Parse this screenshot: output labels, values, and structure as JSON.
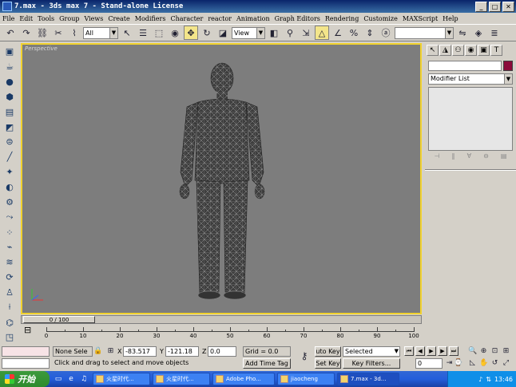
{
  "window": {
    "title": "7.max - 3ds max 7 - Stand-alone License",
    "min_label": "_",
    "max_label": "□",
    "close_label": "✕"
  },
  "menu": [
    "File",
    "Edit",
    "Tools",
    "Group",
    "Views",
    "Create",
    "Modifiers",
    "Character",
    "reactor",
    "Animation",
    "Graph Editors",
    "Rendering",
    "Customize",
    "MAXScript",
    "Help"
  ],
  "toolbar": {
    "selection_filter": "All",
    "reference_coord": "View"
  },
  "viewport": {
    "label": "Perspective"
  },
  "command_panel": {
    "modifier_list": "Modifier List",
    "swatch_color": "#8b0a3a"
  },
  "timeslider": {
    "frame_label": "0 / 100",
    "ticks": [
      "0",
      "10",
      "20",
      "30",
      "40",
      "50",
      "60",
      "70",
      "80",
      "90",
      "100"
    ]
  },
  "status": {
    "selection": "None Sele",
    "x_label": "X",
    "x_value": "-83.517",
    "y_label": "Y",
    "y_value": "-121.18",
    "z_label": "Z",
    "z_value": "0.0",
    "grid": "Grid = 0.0",
    "add_time_tag": "Add Time Tag",
    "prompt": "Click and drag to select and move objects",
    "auto_key": "uto Key",
    "set_key": "Set Key",
    "key_mode": "Selected",
    "key_filters": "Key Filters...",
    "frame": "0"
  },
  "taskbar": {
    "start": "开始",
    "tasks": [
      "火星时代...",
      "火星时代...",
      "Adobe Pho...",
      "jiaocheng",
      "7.max - 3d..."
    ],
    "clock": "13:46"
  }
}
